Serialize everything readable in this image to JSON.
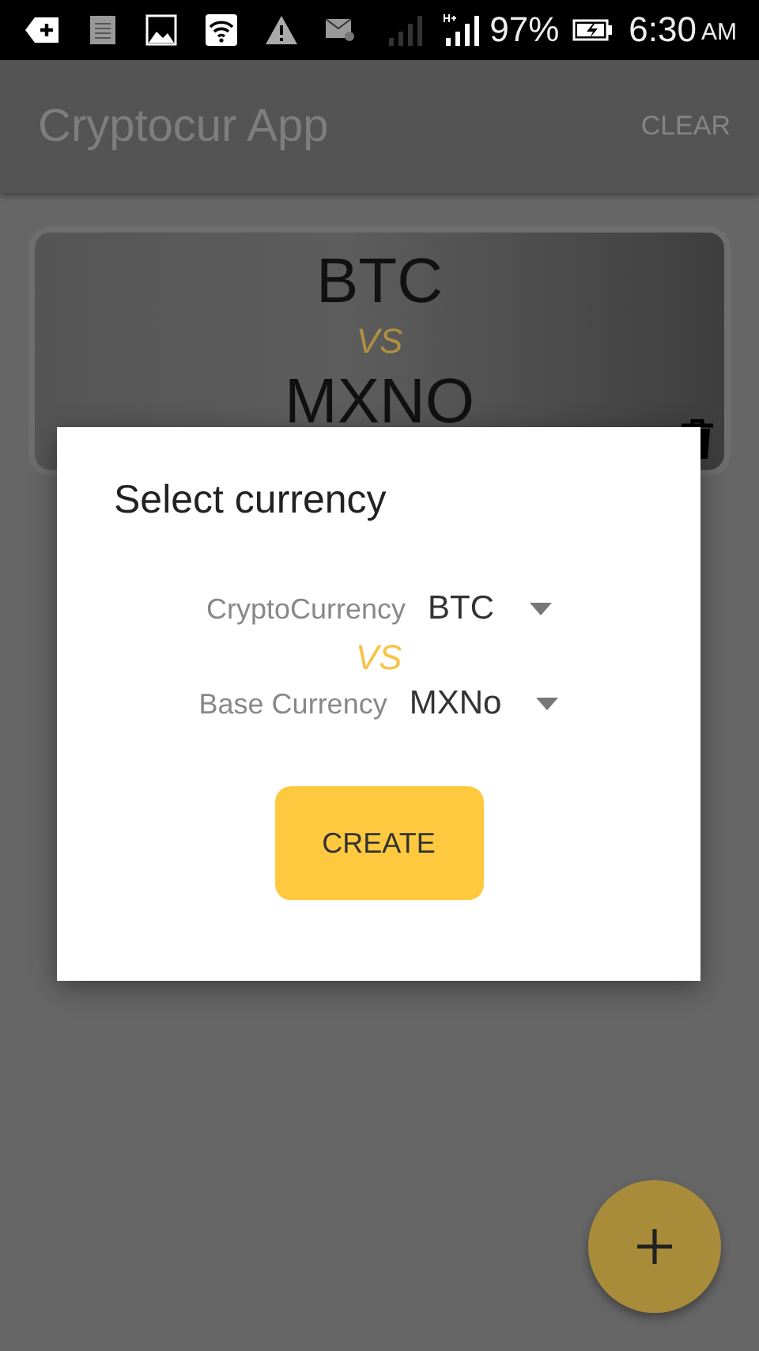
{
  "status_bar": {
    "battery": "97%",
    "time": "6:30",
    "meridiem": "AM"
  },
  "app_bar": {
    "title": "Cryptocur App",
    "action": "CLEAR"
  },
  "cards": [
    {
      "crypto": "BTC",
      "vs": "VS",
      "base": "MXNO"
    }
  ],
  "dialog": {
    "title": "Select currency",
    "vs": "VS",
    "button": "CREATE",
    "fields": [
      {
        "label": "CryptoCurrency",
        "value": "BTC"
      },
      {
        "label": "Base Currency",
        "value": "MXNo"
      }
    ]
  }
}
